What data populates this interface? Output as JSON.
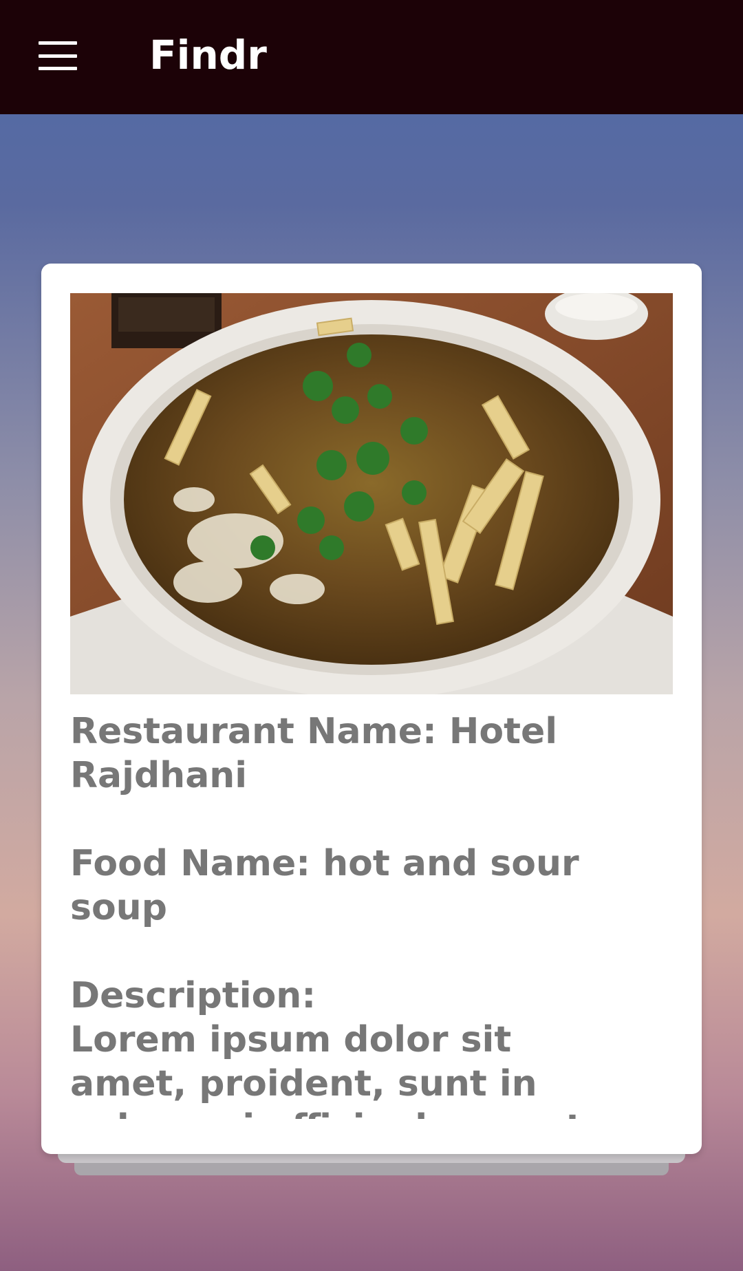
{
  "appbar": {
    "title": "Findr",
    "menu_icon": "hamburger-menu-icon"
  },
  "card": {
    "image_icon": "food-photo-hot-and-sour-soup",
    "restaurant_line": "Restaurant Name: Hotel Rajdhani",
    "food_line": "Food Name: hot and sour soup",
    "description_label": "Description:",
    "description_text": "Lorem ipsum dolor sit amet, proident, sunt in culpa qui officia deserunt mollit anim id est laborum.Ut enim ad minim veniam, quis nostrud"
  },
  "colors": {
    "appbar_bg": "#1c0207",
    "text_gray": "#777777"
  }
}
